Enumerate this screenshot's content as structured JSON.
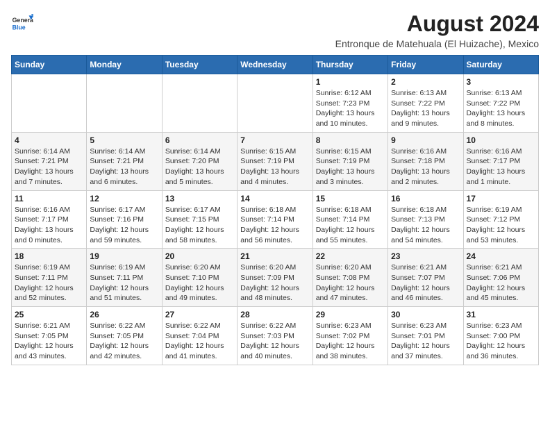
{
  "header": {
    "logo": {
      "general": "General",
      "blue": "Blue"
    },
    "title": "August 2024",
    "location": "Entronque de Matehuala (El Huizache), Mexico"
  },
  "weekdays": [
    "Sunday",
    "Monday",
    "Tuesday",
    "Wednesday",
    "Thursday",
    "Friday",
    "Saturday"
  ],
  "weeks": [
    [
      {
        "day": "",
        "info": ""
      },
      {
        "day": "",
        "info": ""
      },
      {
        "day": "",
        "info": ""
      },
      {
        "day": "",
        "info": ""
      },
      {
        "day": "1",
        "info": "Sunrise: 6:12 AM\nSunset: 7:23 PM\nDaylight: 13 hours and 10 minutes."
      },
      {
        "day": "2",
        "info": "Sunrise: 6:13 AM\nSunset: 7:22 PM\nDaylight: 13 hours and 9 minutes."
      },
      {
        "day": "3",
        "info": "Sunrise: 6:13 AM\nSunset: 7:22 PM\nDaylight: 13 hours and 8 minutes."
      }
    ],
    [
      {
        "day": "4",
        "info": "Sunrise: 6:14 AM\nSunset: 7:21 PM\nDaylight: 13 hours and 7 minutes."
      },
      {
        "day": "5",
        "info": "Sunrise: 6:14 AM\nSunset: 7:21 PM\nDaylight: 13 hours and 6 minutes."
      },
      {
        "day": "6",
        "info": "Sunrise: 6:14 AM\nSunset: 7:20 PM\nDaylight: 13 hours and 5 minutes."
      },
      {
        "day": "7",
        "info": "Sunrise: 6:15 AM\nSunset: 7:19 PM\nDaylight: 13 hours and 4 minutes."
      },
      {
        "day": "8",
        "info": "Sunrise: 6:15 AM\nSunset: 7:19 PM\nDaylight: 13 hours and 3 minutes."
      },
      {
        "day": "9",
        "info": "Sunrise: 6:16 AM\nSunset: 7:18 PM\nDaylight: 13 hours and 2 minutes."
      },
      {
        "day": "10",
        "info": "Sunrise: 6:16 AM\nSunset: 7:17 PM\nDaylight: 13 hours and 1 minute."
      }
    ],
    [
      {
        "day": "11",
        "info": "Sunrise: 6:16 AM\nSunset: 7:17 PM\nDaylight: 13 hours and 0 minutes."
      },
      {
        "day": "12",
        "info": "Sunrise: 6:17 AM\nSunset: 7:16 PM\nDaylight: 12 hours and 59 minutes."
      },
      {
        "day": "13",
        "info": "Sunrise: 6:17 AM\nSunset: 7:15 PM\nDaylight: 12 hours and 58 minutes."
      },
      {
        "day": "14",
        "info": "Sunrise: 6:18 AM\nSunset: 7:14 PM\nDaylight: 12 hours and 56 minutes."
      },
      {
        "day": "15",
        "info": "Sunrise: 6:18 AM\nSunset: 7:14 PM\nDaylight: 12 hours and 55 minutes."
      },
      {
        "day": "16",
        "info": "Sunrise: 6:18 AM\nSunset: 7:13 PM\nDaylight: 12 hours and 54 minutes."
      },
      {
        "day": "17",
        "info": "Sunrise: 6:19 AM\nSunset: 7:12 PM\nDaylight: 12 hours and 53 minutes."
      }
    ],
    [
      {
        "day": "18",
        "info": "Sunrise: 6:19 AM\nSunset: 7:11 PM\nDaylight: 12 hours and 52 minutes."
      },
      {
        "day": "19",
        "info": "Sunrise: 6:19 AM\nSunset: 7:11 PM\nDaylight: 12 hours and 51 minutes."
      },
      {
        "day": "20",
        "info": "Sunrise: 6:20 AM\nSunset: 7:10 PM\nDaylight: 12 hours and 49 minutes."
      },
      {
        "day": "21",
        "info": "Sunrise: 6:20 AM\nSunset: 7:09 PM\nDaylight: 12 hours and 48 minutes."
      },
      {
        "day": "22",
        "info": "Sunrise: 6:20 AM\nSunset: 7:08 PM\nDaylight: 12 hours and 47 minutes."
      },
      {
        "day": "23",
        "info": "Sunrise: 6:21 AM\nSunset: 7:07 PM\nDaylight: 12 hours and 46 minutes."
      },
      {
        "day": "24",
        "info": "Sunrise: 6:21 AM\nSunset: 7:06 PM\nDaylight: 12 hours and 45 minutes."
      }
    ],
    [
      {
        "day": "25",
        "info": "Sunrise: 6:21 AM\nSunset: 7:05 PM\nDaylight: 12 hours and 43 minutes."
      },
      {
        "day": "26",
        "info": "Sunrise: 6:22 AM\nSunset: 7:05 PM\nDaylight: 12 hours and 42 minutes."
      },
      {
        "day": "27",
        "info": "Sunrise: 6:22 AM\nSunset: 7:04 PM\nDaylight: 12 hours and 41 minutes."
      },
      {
        "day": "28",
        "info": "Sunrise: 6:22 AM\nSunset: 7:03 PM\nDaylight: 12 hours and 40 minutes."
      },
      {
        "day": "29",
        "info": "Sunrise: 6:23 AM\nSunset: 7:02 PM\nDaylight: 12 hours and 38 minutes."
      },
      {
        "day": "30",
        "info": "Sunrise: 6:23 AM\nSunset: 7:01 PM\nDaylight: 12 hours and 37 minutes."
      },
      {
        "day": "31",
        "info": "Sunrise: 6:23 AM\nSunset: 7:00 PM\nDaylight: 12 hours and 36 minutes."
      }
    ]
  ]
}
